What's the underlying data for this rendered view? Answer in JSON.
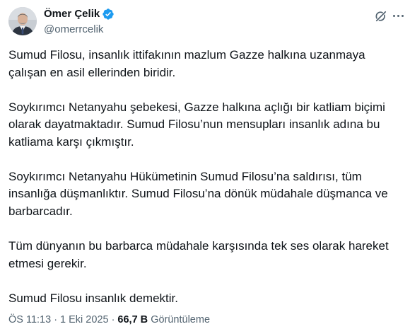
{
  "author": {
    "name": "Ömer Çelik",
    "handle": "@omerrcelik",
    "verified_color": "#1d9bf0"
  },
  "icons": {
    "grok": "grok-icon",
    "more": "more-options-icon",
    "verified": "verified-badge-icon"
  },
  "tweet": {
    "paragraphs": [
      "Sumud Filosu, insanlık ittifakının mazlum Gazze halkına uzanmaya çalışan en asil ellerinden biridir.",
      "Soykırımcı Netanyahu şebekesi, Gazze halkına açlığı bir katliam biçimi olarak dayatmaktadır. Sumud Filosu’nun mensupları insanlık adına bu katliama karşı çıkmıştır.",
      "Soykırımcı Netanyahu Hükümetinin Sumud Filosu’na saldırısı, tüm insanlığa düşmanlıktır. Sumud Filosu’na dönük müdahale düşmanca ve barbarcadır.",
      "Tüm dünyanın bu barbarca müdahale karşısında tek ses olarak hareket etmesi gerekir.",
      "Sumud Filosu insanlık demektir."
    ]
  },
  "meta": {
    "time": "ÖS 11:13",
    "date": "1 Eki 2025",
    "separator": "·",
    "views_count": "66,7 B",
    "views_label": "Görüntüleme"
  }
}
